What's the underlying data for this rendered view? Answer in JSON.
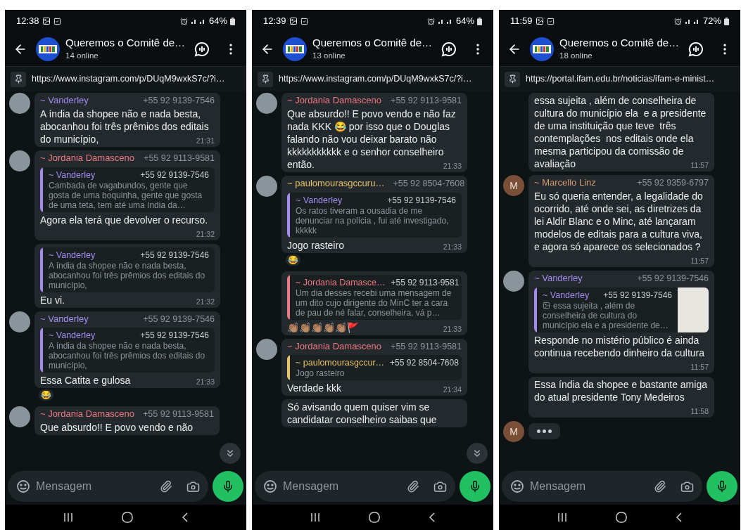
{
  "phones": [
    {
      "status_bar": {
        "time": "12:38",
        "battery": "64%"
      },
      "chat": {
        "title": "Queremos o Comitê de…",
        "subtitle": "14 online"
      },
      "pinned": {
        "text": "https://www.instagram.com/p/DUqM9wxkS7c/?i…"
      },
      "scroll_button": true,
      "composer": {
        "placeholder": "Mensagem"
      },
      "messages": [
        {
          "kind": "text",
          "avatar": {
            "kind": "photo"
          },
          "sender": {
            "name": "~ Vanderley",
            "phone": "+55 92 9139-7546",
            "color": "#a28cf0"
          },
          "text": "A índia da shopee não e nada besta, abocanhou foi três prêmios dos editais do município,",
          "time": "21:31"
        },
        {
          "kind": "text",
          "avatar": {
            "kind": "photo"
          },
          "sender": {
            "name": "~ Jordania Damasceno",
            "phone": "+55 92 9113-9581",
            "color": "#ec7a82"
          },
          "quote": {
            "name": "~ Vanderley",
            "phone": "+55 92 9139-7546",
            "color": "#a28cf0",
            "text": "Cambada de vagabundos, gente que gosta de uma boquinha, gente que gosta de uma teta, tem até uma índia da…"
          },
          "text": "Agora ela terá que devolver o recurso.",
          "time": "21:32"
        },
        {
          "kind": "text",
          "quote": {
            "name": "~ Vanderley",
            "phone": "+55 92 9139-7546",
            "color": "#a28cf0",
            "text": "A índia da shopee não e nada besta, abocanhou foi três prêmios dos editais do município,"
          },
          "text": "Eu vi.",
          "time": "21:32"
        },
        {
          "kind": "text",
          "avatar": {
            "kind": "photo"
          },
          "sender": {
            "name": "~ Vanderley",
            "phone": "+55 92 9139-7546",
            "color": "#a28cf0"
          },
          "quote": {
            "name": "~ Vanderley",
            "phone": "+55 92 9139-7546",
            "color": "#a28cf0",
            "text": "A índia da shopee não e nada besta, abocanhou foi três prêmios dos editais do município,"
          },
          "text": "Essa Catita e gulosa",
          "time": "21:33",
          "reaction": "😂"
        },
        {
          "kind": "text",
          "avatar": {
            "kind": "photo"
          },
          "sender": {
            "name": "~ Jordania Damasceno",
            "phone": "+55 92 9113-9581",
            "color": "#ec7a82"
          },
          "text": "Que absurdo!! E povo vendo e não"
        }
      ]
    },
    {
      "status_bar": {
        "time": "12:39",
        "battery": "64%"
      },
      "chat": {
        "title": "Queremos o Comitê de…",
        "subtitle": "13 online"
      },
      "pinned": {
        "text": "https://www.instagram.com/p/DUqM9wxkS7c/?i…"
      },
      "scroll_button": true,
      "composer": {
        "placeholder": "Mensagem"
      },
      "messages": [
        {
          "kind": "text",
          "avatar": {
            "kind": "photo"
          },
          "sender": {
            "name": "~ Jordania Damasceno",
            "phone": "+55 92 9113-9581",
            "color": "#ec7a82"
          },
          "text": "Que absurdo!! E povo vendo e não faz nada KKK 😂 por isso que o Douglas falando não vou deixar barato não kkkkkkkkkkk e o senhor conselheiro então.",
          "time": "21:33"
        },
        {
          "kind": "text",
          "avatar": {
            "kind": "photo"
          },
          "sender": {
            "name": "~ paulomourasgccuru…",
            "phone": "+55 92 8504-7608",
            "color": "#e8c36a"
          },
          "quote": {
            "name": "~ Vanderley",
            "phone": "+55 92 9139-7546",
            "color": "#a28cf0",
            "text": "Os ratos tiveram a ousadia de me denunciar na polícia , fui até investigado, kkkkk"
          },
          "text": "Jogo rasteiro",
          "time": "21:33",
          "reaction": "😂"
        },
        {
          "kind": "text",
          "quote": {
            "name": "~ Jordania Damasce…",
            "phone": "+55 92 9113-9581",
            "color": "#ec7a82",
            "text": "Um dia desses recebi uma mensagem de um dito cujo dirigente do MinC ter a cara de pau de né falar, conselheira, vá p…"
          },
          "text": "👏🏽👏🏽👏🏽👏🏽👏🏽🚩",
          "time": "21:33"
        },
        {
          "kind": "text",
          "avatar": {
            "kind": "photo"
          },
          "sender": {
            "name": "~ Jordania Damasceno",
            "phone": "+55 92 9113-9581",
            "color": "#ec7a82"
          },
          "quote": {
            "name": "~ paulomourasgccur…",
            "phone": "+55 92 8504-7608",
            "color": "#e8c36a",
            "text": "Jogo rasteiro"
          },
          "text": "Verdade kkk",
          "time": "21:34"
        },
        {
          "kind": "text",
          "text": "Só avisando quem quiser vim se candidatar conselheiro saibas que"
        }
      ]
    },
    {
      "status_bar": {
        "time": "11:59",
        "battery": "72%"
      },
      "chat": {
        "title": "Queremos o Comitê de…",
        "subtitle": "18 online"
      },
      "pinned": {
        "text": "https://portal.ifam.edu.br/noticias/ifam-e-minist…"
      },
      "scroll_button": false,
      "composer": {
        "placeholder": "Mensagem"
      },
      "messages": [
        {
          "kind": "text",
          "text": "essa sujeita , além de conselheira de cultura do município ela  e a presidente de uma instituição que teve  três contemplações  nos editais onde ela mesma participou da comissão de avaliação",
          "time": "11:57"
        },
        {
          "kind": "text",
          "avatar": {
            "kind": "letter",
            "letter": "M"
          },
          "sender": {
            "name": "~ Marcello Linz",
            "phone": "+55 92 9359-6797",
            "color": "#d49a74"
          },
          "text": "Eu só queria entender, a legalidade do ocorrido, até onde sei, as diretrizes da lei Aldir Blanc e o Minc, até lançaram modelos de editais para a cultura viva, e agora só aparece os selecionados ?",
          "time": "11:57"
        },
        {
          "kind": "text",
          "avatar": {
            "kind": "photo"
          },
          "sender": {
            "name": "~ Vanderley",
            "phone": "+55 92 9139-7546",
            "color": "#a28cf0"
          },
          "quote": {
            "name": "~ Vanderley",
            "phone": "+55 92 9139-7546",
            "color": "#a28cf0",
            "text": "essa sujeita , além de conselheira de cultura do município ela  e a presidente de…",
            "image": true
          },
          "text": "Responde no mistério público é ainda continua recebendo dinheiro da cultura",
          "time": "11:57"
        },
        {
          "kind": "text",
          "text": "Essa índia da shopee e bastante amiga do atual presidente Tony Medeiros",
          "time": "11:58"
        },
        {
          "kind": "typing",
          "avatar": {
            "kind": "letter",
            "letter": "M"
          }
        }
      ]
    }
  ]
}
